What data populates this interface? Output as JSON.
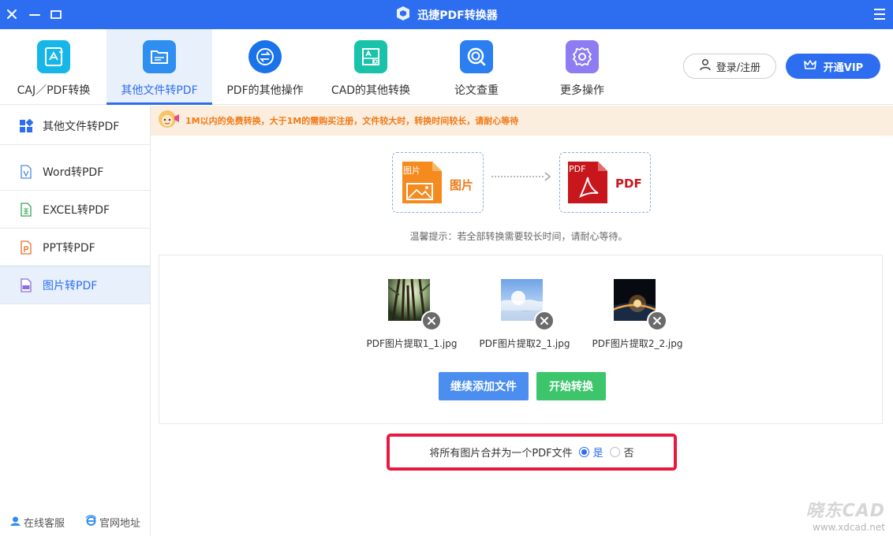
{
  "window": {
    "title": "迅捷PDF转换器"
  },
  "toolbar": {
    "tabs": [
      {
        "label": "CAJ／PDF转换",
        "icon": "caj-pdf-icon",
        "color": "#16b7e8"
      },
      {
        "label": "其他文件转PDF",
        "icon": "folder-icon",
        "color": "#2e8ff0"
      },
      {
        "label": "PDF的其他操作",
        "icon": "swap-icon",
        "color": "#1a73e8"
      },
      {
        "label": "CAD的其他转换",
        "icon": "cad-icon",
        "color": "#19c3a9"
      },
      {
        "label": "论文查重",
        "icon": "search-check-icon",
        "color": "#2c7ff0"
      },
      {
        "label": "更多操作",
        "icon": "gear-icon",
        "color": "#8e7cf2"
      }
    ],
    "login_label": "登录/注册",
    "vip_label": "开通VIP"
  },
  "sidebar": {
    "items": [
      {
        "label": "其他文件转PDF",
        "icon": "grid-icon"
      },
      {
        "label": "Word转PDF",
        "icon": "word-file-icon"
      },
      {
        "label": "EXCEL转PDF",
        "icon": "excel-file-icon"
      },
      {
        "label": "PPT转PDF",
        "icon": "ppt-file-icon"
      },
      {
        "label": "图片转PDF",
        "icon": "jpg-file-icon"
      }
    ],
    "service_label": "在线客服",
    "website_label": "官网地址"
  },
  "notice": {
    "text": "1M以内的免费转换，大于1M的需购买注册，文件较大时，转换时间较长，请耐心等待"
  },
  "conversion": {
    "source_badge": "图片",
    "source_label": "图片",
    "target_badge": "PDF",
    "target_label": "PDF",
    "hint": "温馨提示：若全部转换需要较长时间，请耐心等待。"
  },
  "files": [
    {
      "name": "PDF图片提取1_1.jpg",
      "thumb": "forest"
    },
    {
      "name": "PDF图片提取2_1.jpg",
      "thumb": "sky"
    },
    {
      "name": "PDF图片提取2_2.jpg",
      "thumb": "earth"
    }
  ],
  "actions": {
    "add_label": "继续添加文件",
    "start_label": "开始转换"
  },
  "merge": {
    "label": "将所有图片合并为一个PDF文件",
    "yes_label": "是",
    "no_label": "否",
    "selected": "yes"
  },
  "watermark": {
    "main": "晓东CAD",
    "url": "www.xdcad.net"
  }
}
